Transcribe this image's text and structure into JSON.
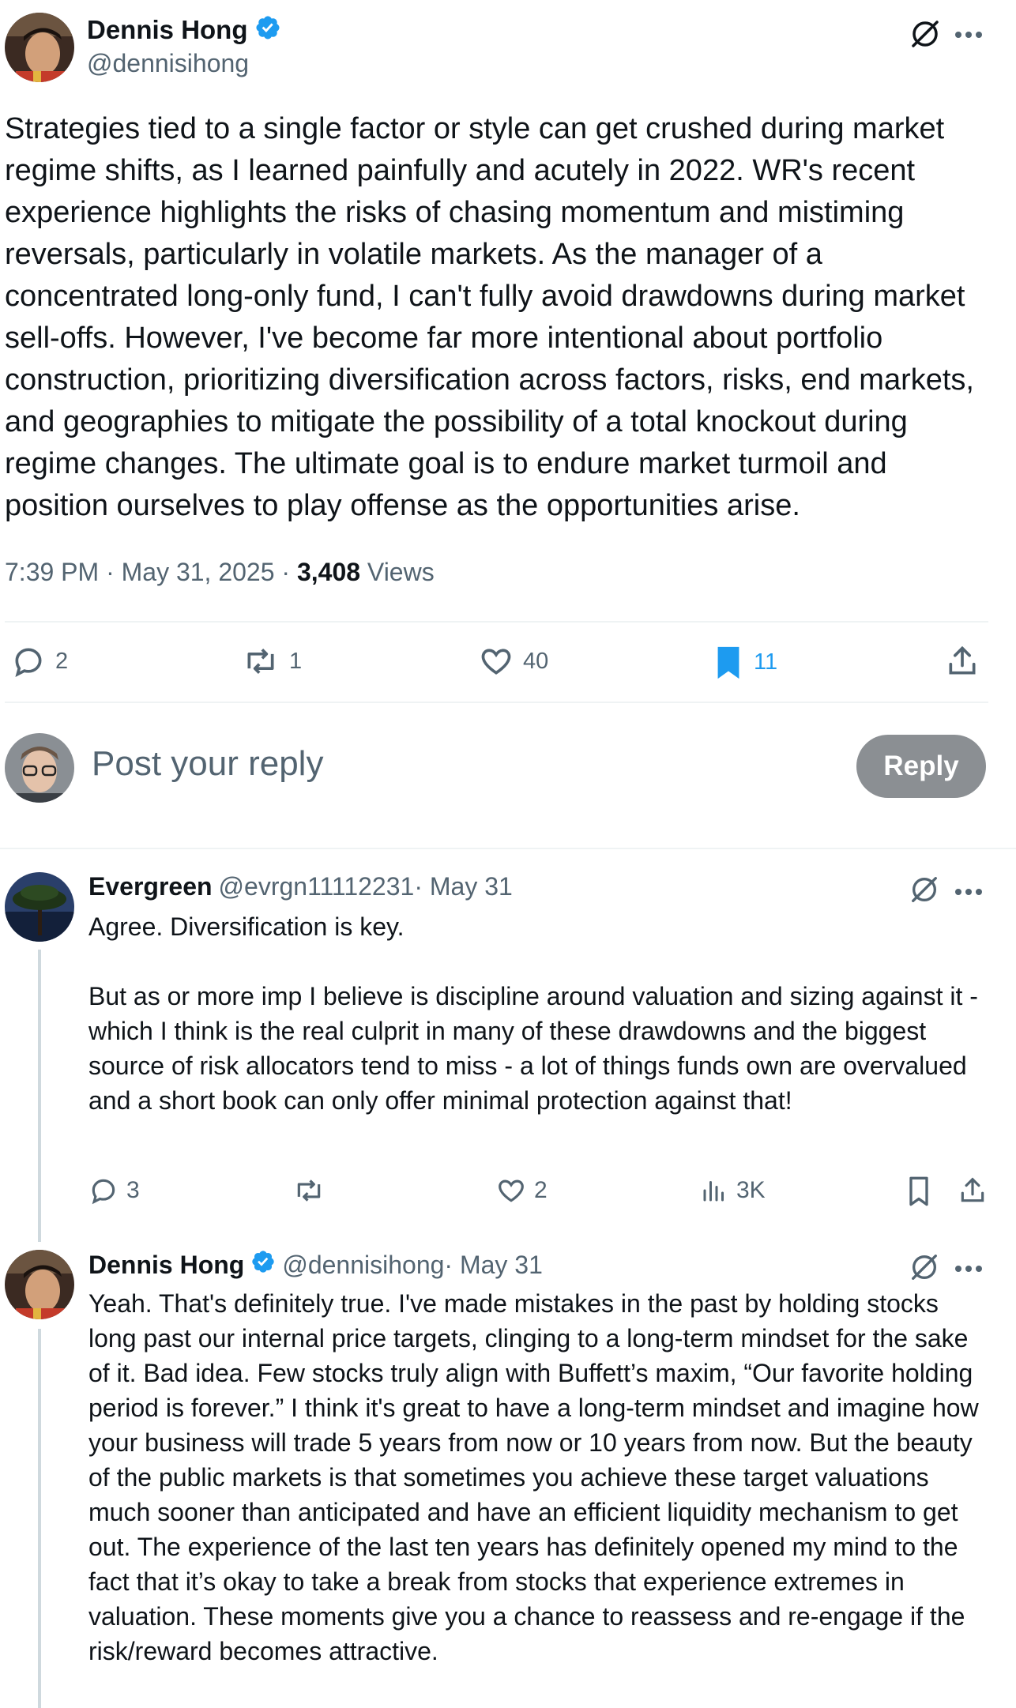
{
  "main_tweet": {
    "author_name": "Dennis Hong",
    "handle": "@dennisihong",
    "text": "Strategies tied to a single factor or style can get crushed during market regime shifts, as I learned painfully and acutely in 2022. WR's recent experience highlights the risks of chasing momentum and mistiming reversals, particularly in volatile markets. As the manager of a concentrated long-only fund, I can't fully avoid drawdowns during market sell-offs. However, I've become far more intentional about portfolio construction, prioritizing diversification across factors, risks, end markets, and geographies to mitigate the possibility of a total knockout during regime changes. The ultimate goal is to endure market turmoil and position ourselves to play offense as the opportunities arise.",
    "timestamp": "7:39 PM · May 31, 2025 · ",
    "views_count": "3,408",
    "views_label": " Views",
    "replies": "2",
    "reposts": "1",
    "likes": "40",
    "bookmarks": "11"
  },
  "compose": {
    "placeholder": "Post your reply",
    "button_label": "Reply"
  },
  "replies": [
    {
      "author_name": "Evergreen",
      "handle": "@evrgn11112231",
      "date": " · May 31",
      "text": "Agree. Diversification is key.\n\nBut as or more imp I believe is discipline around valuation and sizing against it - which I think is the real culprit in many of these drawdowns and the biggest source of risk allocators tend to miss - a lot of things funds own are overvalued and a short book can only offer minimal protection against that!",
      "replies": "3",
      "reposts": "",
      "likes": "2",
      "views": "3K"
    },
    {
      "author_name": "Dennis Hong",
      "handle": "@dennisihong",
      "date": " · May 31",
      "text": "Yeah. That's definitely true. I've made mistakes in the past by holding stocks long past our internal price targets, clinging to a long-term mindset for the sake of it. Bad idea. Few stocks truly align with Buffett’s maxim, “Our favorite holding period is forever.” I think it's great to have a long-term mindset and imagine how your business will trade 5 years from now or 10 years from now. But the beauty of the public markets is that sometimes you achieve these target valuations much sooner than anticipated and have an efficient liquidity mechanism to get out. The experience of the last ten years has definitely opened my mind to the fact that it’s okay to take a break from stocks that experience extremes in valuation. These moments give you a chance to reassess and re-engage if the risk/reward becomes attractive."
    }
  ],
  "colors": {
    "text": "#0f1419",
    "muted": "#536471",
    "verified": "#1d9bf0",
    "bookmark_active": "#1d9bf0",
    "reply_button": "#8b8f93",
    "divider": "#eff3f4"
  },
  "icons": [
    "verified-badge-icon",
    "grok-icon",
    "more-icon",
    "reply-icon",
    "repost-icon",
    "like-icon",
    "bookmark-icon",
    "share-icon",
    "views-icon"
  ]
}
